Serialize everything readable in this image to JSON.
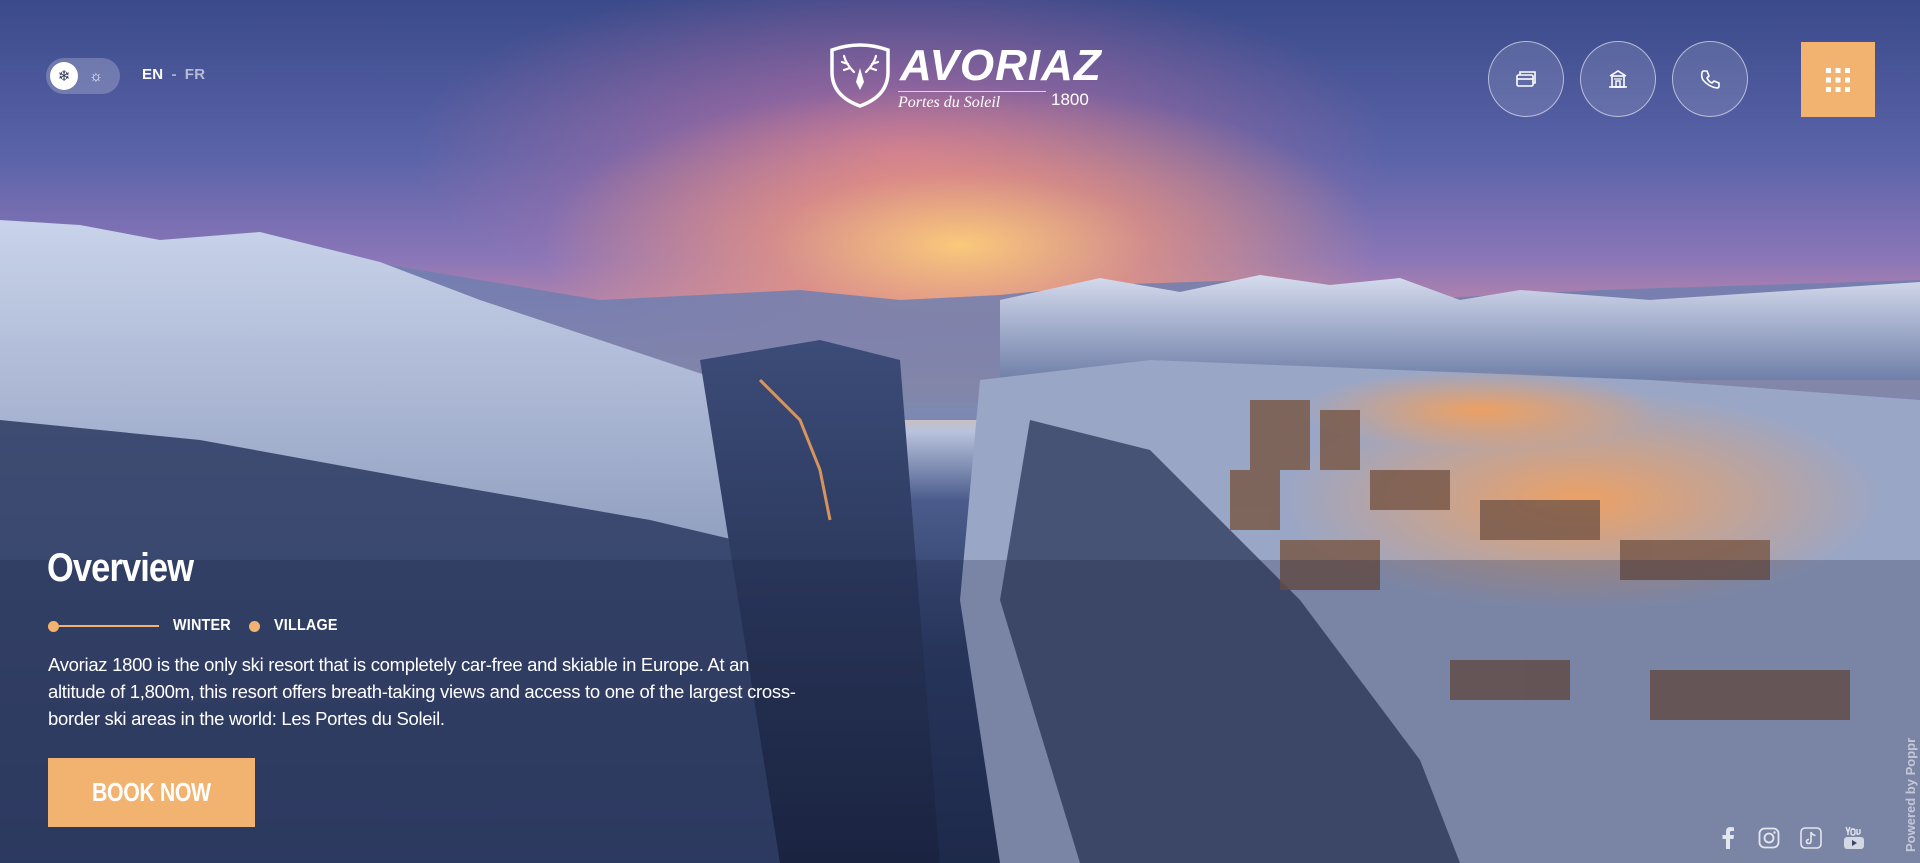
{
  "header": {
    "season_toggle": {
      "options": [
        "winter",
        "summer"
      ],
      "active": "winter",
      "winter_icon": "snowflake-icon",
      "summer_icon": "sun-icon"
    },
    "languages": {
      "en": "EN",
      "separator": "-",
      "fr": "FR",
      "active": "EN"
    },
    "logo": {
      "brand": "AVORIAZ",
      "tagline": "Portes du Soleil",
      "altitude": "1800",
      "icon": "deer-crest-icon"
    },
    "buttons": [
      {
        "name": "ski-pass",
        "icon": "ticket-card-icon"
      },
      {
        "name": "accommodation",
        "icon": "hotel-building-icon"
      },
      {
        "name": "contact",
        "icon": "phone-icon"
      }
    ],
    "menu_icon": "grid-menu-icon"
  },
  "overview": {
    "title": "Overview",
    "tabs": [
      "WINTER",
      "VILLAGE"
    ],
    "description": "Avoriaz 1800 is the only ski resort that is completely car-free and skiable in Europe. At an altitude of 1,800m, this resort offers breath-taking views and access to one of the largest cross-border ski areas in the world: Les Portes du Soleil.",
    "book_label": "BOOK NOW"
  },
  "footer": {
    "social": [
      "facebook-icon",
      "instagram-icon",
      "tiktok-icon",
      "youtube-icon"
    ],
    "powered_by": "Powered by Poppr"
  },
  "colors": {
    "accent": "#f2b370",
    "text": "#ffffff"
  }
}
